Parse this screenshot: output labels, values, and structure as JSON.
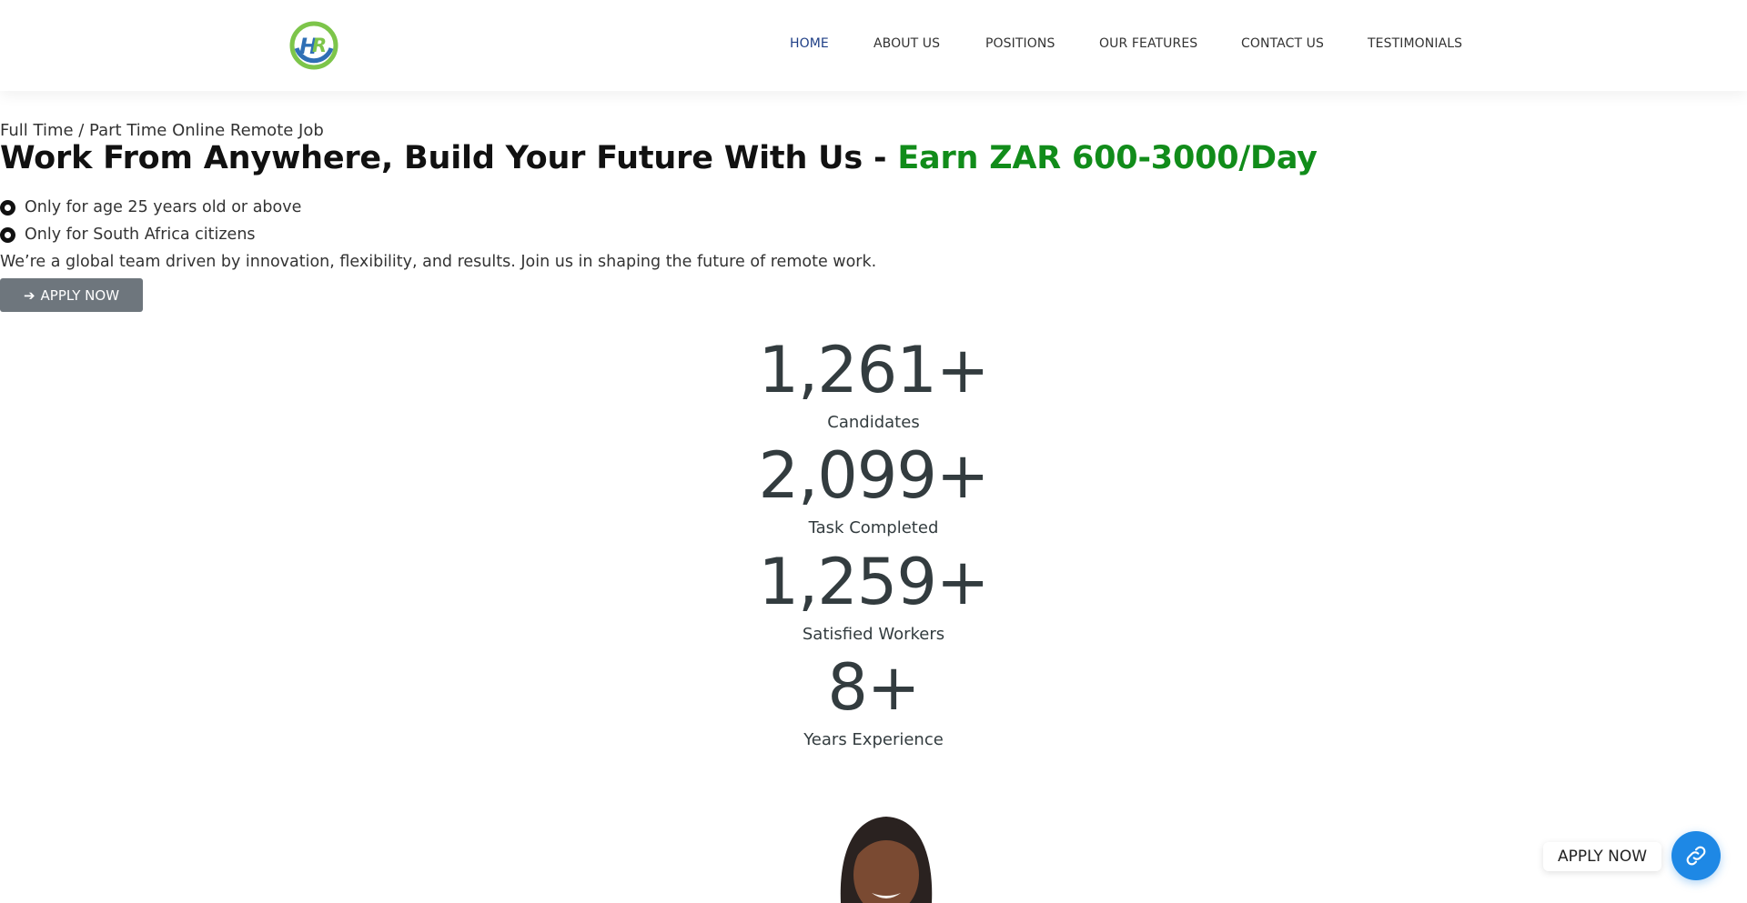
{
  "brand": {
    "logo_text": "HR",
    "colors": {
      "ring": "#7dc54a",
      "h": "#2f6fb5",
      "r": "#7dc54a"
    }
  },
  "nav": {
    "items": [
      {
        "label": "HOME",
        "active": true
      },
      {
        "label": "ABOUT US",
        "active": false
      },
      {
        "label": "POSITIONS",
        "active": false
      },
      {
        "label": "OUR FEATURES",
        "active": false
      },
      {
        "label": "CONTACT US",
        "active": false
      },
      {
        "label": "TESTIMONIALS",
        "active": false
      }
    ]
  },
  "hero": {
    "eyebrow": "Full Time / Part Time Online Remote Job",
    "headline": "Work From Anywhere, Build Your Future With Us - ",
    "headline_accent": "Earn ZAR 600-3000/Day",
    "bullets": [
      "Only for age 25 years old or above",
      "Only for South Africa citizens"
    ],
    "intro": "We’re a global team driven by innovation, flexibility, and results. Join us in shaping the future of remote work.",
    "apply_button": "APPLY NOW"
  },
  "stats": [
    {
      "value": "1,261+",
      "label": "Candidates"
    },
    {
      "value": "2,099+",
      "label": "Task Completed"
    },
    {
      "value": "1,259+",
      "label": "Satisfied Workers"
    },
    {
      "value": "8+",
      "label": "Years Experience"
    }
  ],
  "floating": {
    "label": "APPLY NOW",
    "icon": "link-icon",
    "color": "#1e88e5"
  },
  "colors": {
    "accent_green": "#118c1a",
    "nav_active": "#1f3f86",
    "button_gray": "#6e767d"
  }
}
